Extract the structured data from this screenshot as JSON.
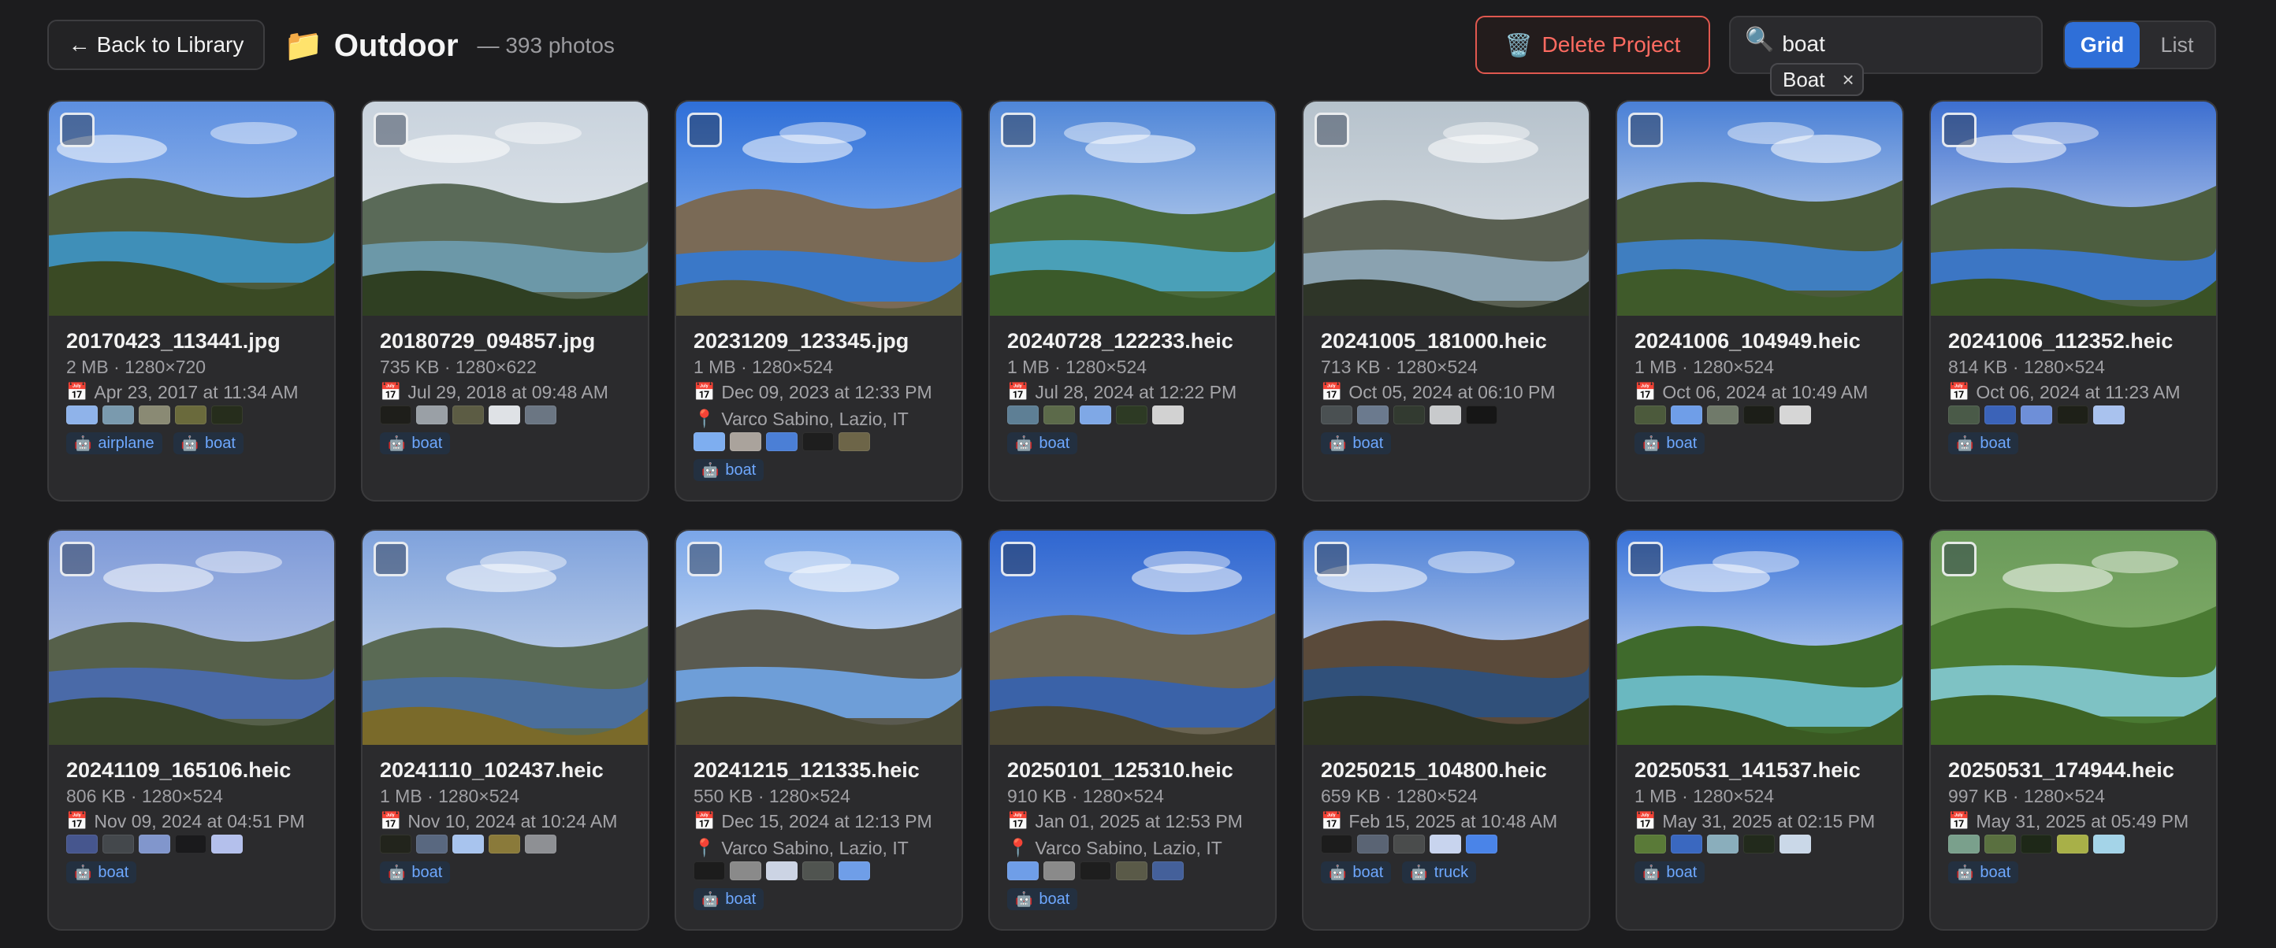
{
  "header": {
    "back_label": "Back to Library",
    "back_arrow": "←",
    "folder_icon": "📁",
    "title": "Outdoor",
    "count": "— 393 photos",
    "delete_icon": "🗑️",
    "delete_label": "Delete Project",
    "search_icon": "🔍",
    "search_value": "boat",
    "filter_chip": "Boat",
    "filter_chip_close": "×",
    "view_grid": "Grid",
    "view_list": "List"
  },
  "icons": {
    "calendar": "📅",
    "pin": "📍",
    "robot": "🤖"
  },
  "photos": [
    {
      "name": "20170423_113441.jpg",
      "meta": "2 MB · 1280×720",
      "date": "Apr 23, 2017 at 11:34 AM",
      "location": "",
      "swatches": [
        "#8fb3ea",
        "#7a9aae",
        "#8a8a74",
        "#6a6a3c",
        "#262d1c"
      ],
      "tags": [
        "airplane",
        "boat"
      ],
      "palette": {
        "sky": "#5d8fe0",
        "sky2": "#b8d0f4",
        "water": "#3f8fb8",
        "hill": "#4d5a3a",
        "fg": "#3a4a24"
      }
    },
    {
      "name": "20180729_094857.jpg",
      "meta": "735 KB · 1280×622",
      "date": "Jul 29, 2018 at 09:48 AM",
      "location": "",
      "swatches": [
        "#1e1e1a",
        "#9aa0a6",
        "#5c5c44",
        "#dfe2e6",
        "#6b7683"
      ],
      "tags": [
        "boat"
      ],
      "palette": {
        "sky": "#c9d3dd",
        "sky2": "#e7ebef",
        "water": "#6c98a8",
        "hill": "#5a6a58",
        "fg": "#2f3f22"
      }
    },
    {
      "name": "20231209_123345.jpg",
      "meta": "1 MB · 1280×524",
      "date": "Dec 09, 2023 at 12:33 PM",
      "location": "Varco Sabino, Lazio, IT",
      "swatches": [
        "#7eaef0",
        "#aaa39c",
        "#4b7fd6",
        "#1e1e1e",
        "#6d6548"
      ],
      "tags": [
        "boat"
      ],
      "palette": {
        "sky": "#2f6fd8",
        "sky2": "#9cc2f4",
        "water": "#3a78c8",
        "hill": "#7a6a56",
        "fg": "#5a5a3a"
      }
    },
    {
      "name": "20240728_122233.heic",
      "meta": "1 MB · 1280×524",
      "date": "Jul 28, 2024 at 12:22 PM",
      "location": "",
      "swatches": [
        "#5e7f95",
        "#5c6a4a",
        "#7fa8e6",
        "#2d3a24",
        "#d2d2d2"
      ],
      "tags": [
        "boat"
      ],
      "palette": {
        "sky": "#4f86d8",
        "sky2": "#dfe8f4",
        "water": "#4aa0b8",
        "hill": "#4a6a3c",
        "fg": "#3b5a2a"
      }
    },
    {
      "name": "20241005_181000.heic",
      "meta": "713 KB · 1280×524",
      "date": "Oct 05, 2024 at 06:10 PM",
      "location": "",
      "swatches": [
        "#4a5052",
        "#6b7a8e",
        "#323a30",
        "#c8cacc",
        "#161616"
      ],
      "tags": [
        "boat"
      ],
      "palette": {
        "sky": "#b6c2cc",
        "sky2": "#e0e4e8",
        "water": "#8aa2b0",
        "hill": "#5a6052",
        "fg": "#2e3528"
      }
    },
    {
      "name": "20241006_104949.heic",
      "meta": "1 MB · 1280×524",
      "date": "Oct 06, 2024 at 10:49 AM",
      "location": "",
      "swatches": [
        "#4c5a3c",
        "#6f9ee8",
        "#707a6a",
        "#1c1e18",
        "#d6d6d6"
      ],
      "tags": [
        "boat"
      ],
      "palette": {
        "sky": "#4a80d6",
        "sky2": "#eef2f6",
        "water": "#3f7ec0",
        "hill": "#4a5a3a",
        "fg": "#3f5a2a"
      }
    },
    {
      "name": "20241006_112352.heic",
      "meta": "814 KB · 1280×524",
      "date": "Oct 06, 2024 at 11:23 AM",
      "location": "",
      "swatches": [
        "#4a5a48",
        "#3b63b8",
        "#6e8fd8",
        "#1e2018",
        "#a9c2ee"
      ],
      "tags": [
        "boat"
      ],
      "palette": {
        "sky": "#3d6fd0",
        "sky2": "#e6edf6",
        "water": "#3c76c4",
        "hill": "#4d5e40",
        "fg": "#3a5226"
      }
    },
    {
      "name": "20241109_165106.heic",
      "meta": "806 KB · 1280×524",
      "date": "Nov 09, 2024 at 04:51 PM",
      "location": "",
      "swatches": [
        "#46568e",
        "#44484c",
        "#8196cc",
        "#1a1a1c",
        "#b4c0ec"
      ],
      "tags": [
        "boat"
      ],
      "palette": {
        "sky": "#7e9ad8",
        "sky2": "#c8d4ec",
        "water": "#4a6aa8",
        "hill": "#56604a",
        "fg": "#3a462a"
      }
    },
    {
      "name": "20241110_102437.heic",
      "meta": "1 MB · 1280×524",
      "date": "Nov 10, 2024 at 10:24 AM",
      "location": "",
      "swatches": [
        "#22241c",
        "#596880",
        "#a8c4ee",
        "#8a7a3a",
        "#8e9094"
      ],
      "tags": [
        "boat"
      ],
      "palette": {
        "sky": "#7fa2dc",
        "sky2": "#dbe4f0",
        "water": "#4a6e9c",
        "hill": "#5a6a54",
        "fg": "#7a6a2a"
      }
    },
    {
      "name": "20241215_121335.heic",
      "meta": "550 KB · 1280×524",
      "date": "Dec 15, 2024 at 12:13 PM",
      "location": "Varco Sabino, Lazio, IT",
      "swatches": [
        "#1c1c1c",
        "#8a8a8a",
        "#ccd4e4",
        "#505450",
        "#6f9ee8"
      ],
      "tags": [
        "boat"
      ],
      "palette": {
        "sky": "#7aa6e8",
        "sky2": "#f2f4f8",
        "water": "#6e9ed8",
        "hill": "#5a5a50",
        "fg": "#4a4a36"
      }
    },
    {
      "name": "20250101_125310.heic",
      "meta": "910 KB · 1280×524",
      "date": "Jan 01, 2025 at 12:53 PM",
      "location": "Varco Sabino, Lazio, IT",
      "swatches": [
        "#6f9ee8",
        "#8a8a8a",
        "#1e1e1e",
        "#5a5a48",
        "#44609a"
      ],
      "tags": [
        "boat"
      ],
      "palette": {
        "sky": "#2f66d0",
        "sky2": "#8fb4ec",
        "water": "#3a62a8",
        "hill": "#6a6452",
        "fg": "#4a4632"
      }
    },
    {
      "name": "20250215_104800.heic",
      "meta": "659 KB · 1280×524",
      "date": "Feb 15, 2025 at 10:48 AM",
      "location": "",
      "swatches": [
        "#1c1c1c",
        "#5a6474",
        "#4a4c4c",
        "#c8d4ee",
        "#4a84e8"
      ],
      "tags": [
        "boat",
        "truck"
      ],
      "palette": {
        "sky": "#4f82d8",
        "sky2": "#eef0f4",
        "water": "#30507a",
        "hill": "#5a4a3a",
        "fg": "#2f3422"
      }
    },
    {
      "name": "20250531_141537.heic",
      "meta": "1 MB · 1280×524",
      "date": "May 31, 2025 at 02:15 PM",
      "location": "",
      "swatches": [
        "#5a7a38",
        "#3a68c0",
        "#8aaebc",
        "#222a1c",
        "#cad8e8"
      ],
      "tags": [
        "boat"
      ],
      "palette": {
        "sky": "#3872d8",
        "sky2": "#f2f6fa",
        "water": "#6ab8c0",
        "hill": "#3f6a2c",
        "fg": "#3a5a22"
      }
    },
    {
      "name": "20250531_174944.heic",
      "meta": "997 KB · 1280×524",
      "date": "May 31, 2025 at 05:49 PM",
      "location": "",
      "swatches": [
        "#7aa08c",
        "#5a7040",
        "#1e2818",
        "#a8b048",
        "#a4d4e8"
      ],
      "tags": [
        "boat"
      ],
      "palette": {
        "sky": "#6a9a5a",
        "sky2": "#8fb870",
        "water": "#7ec2c4",
        "hill": "#4a7a32",
        "fg": "#3e6424"
      }
    }
  ]
}
